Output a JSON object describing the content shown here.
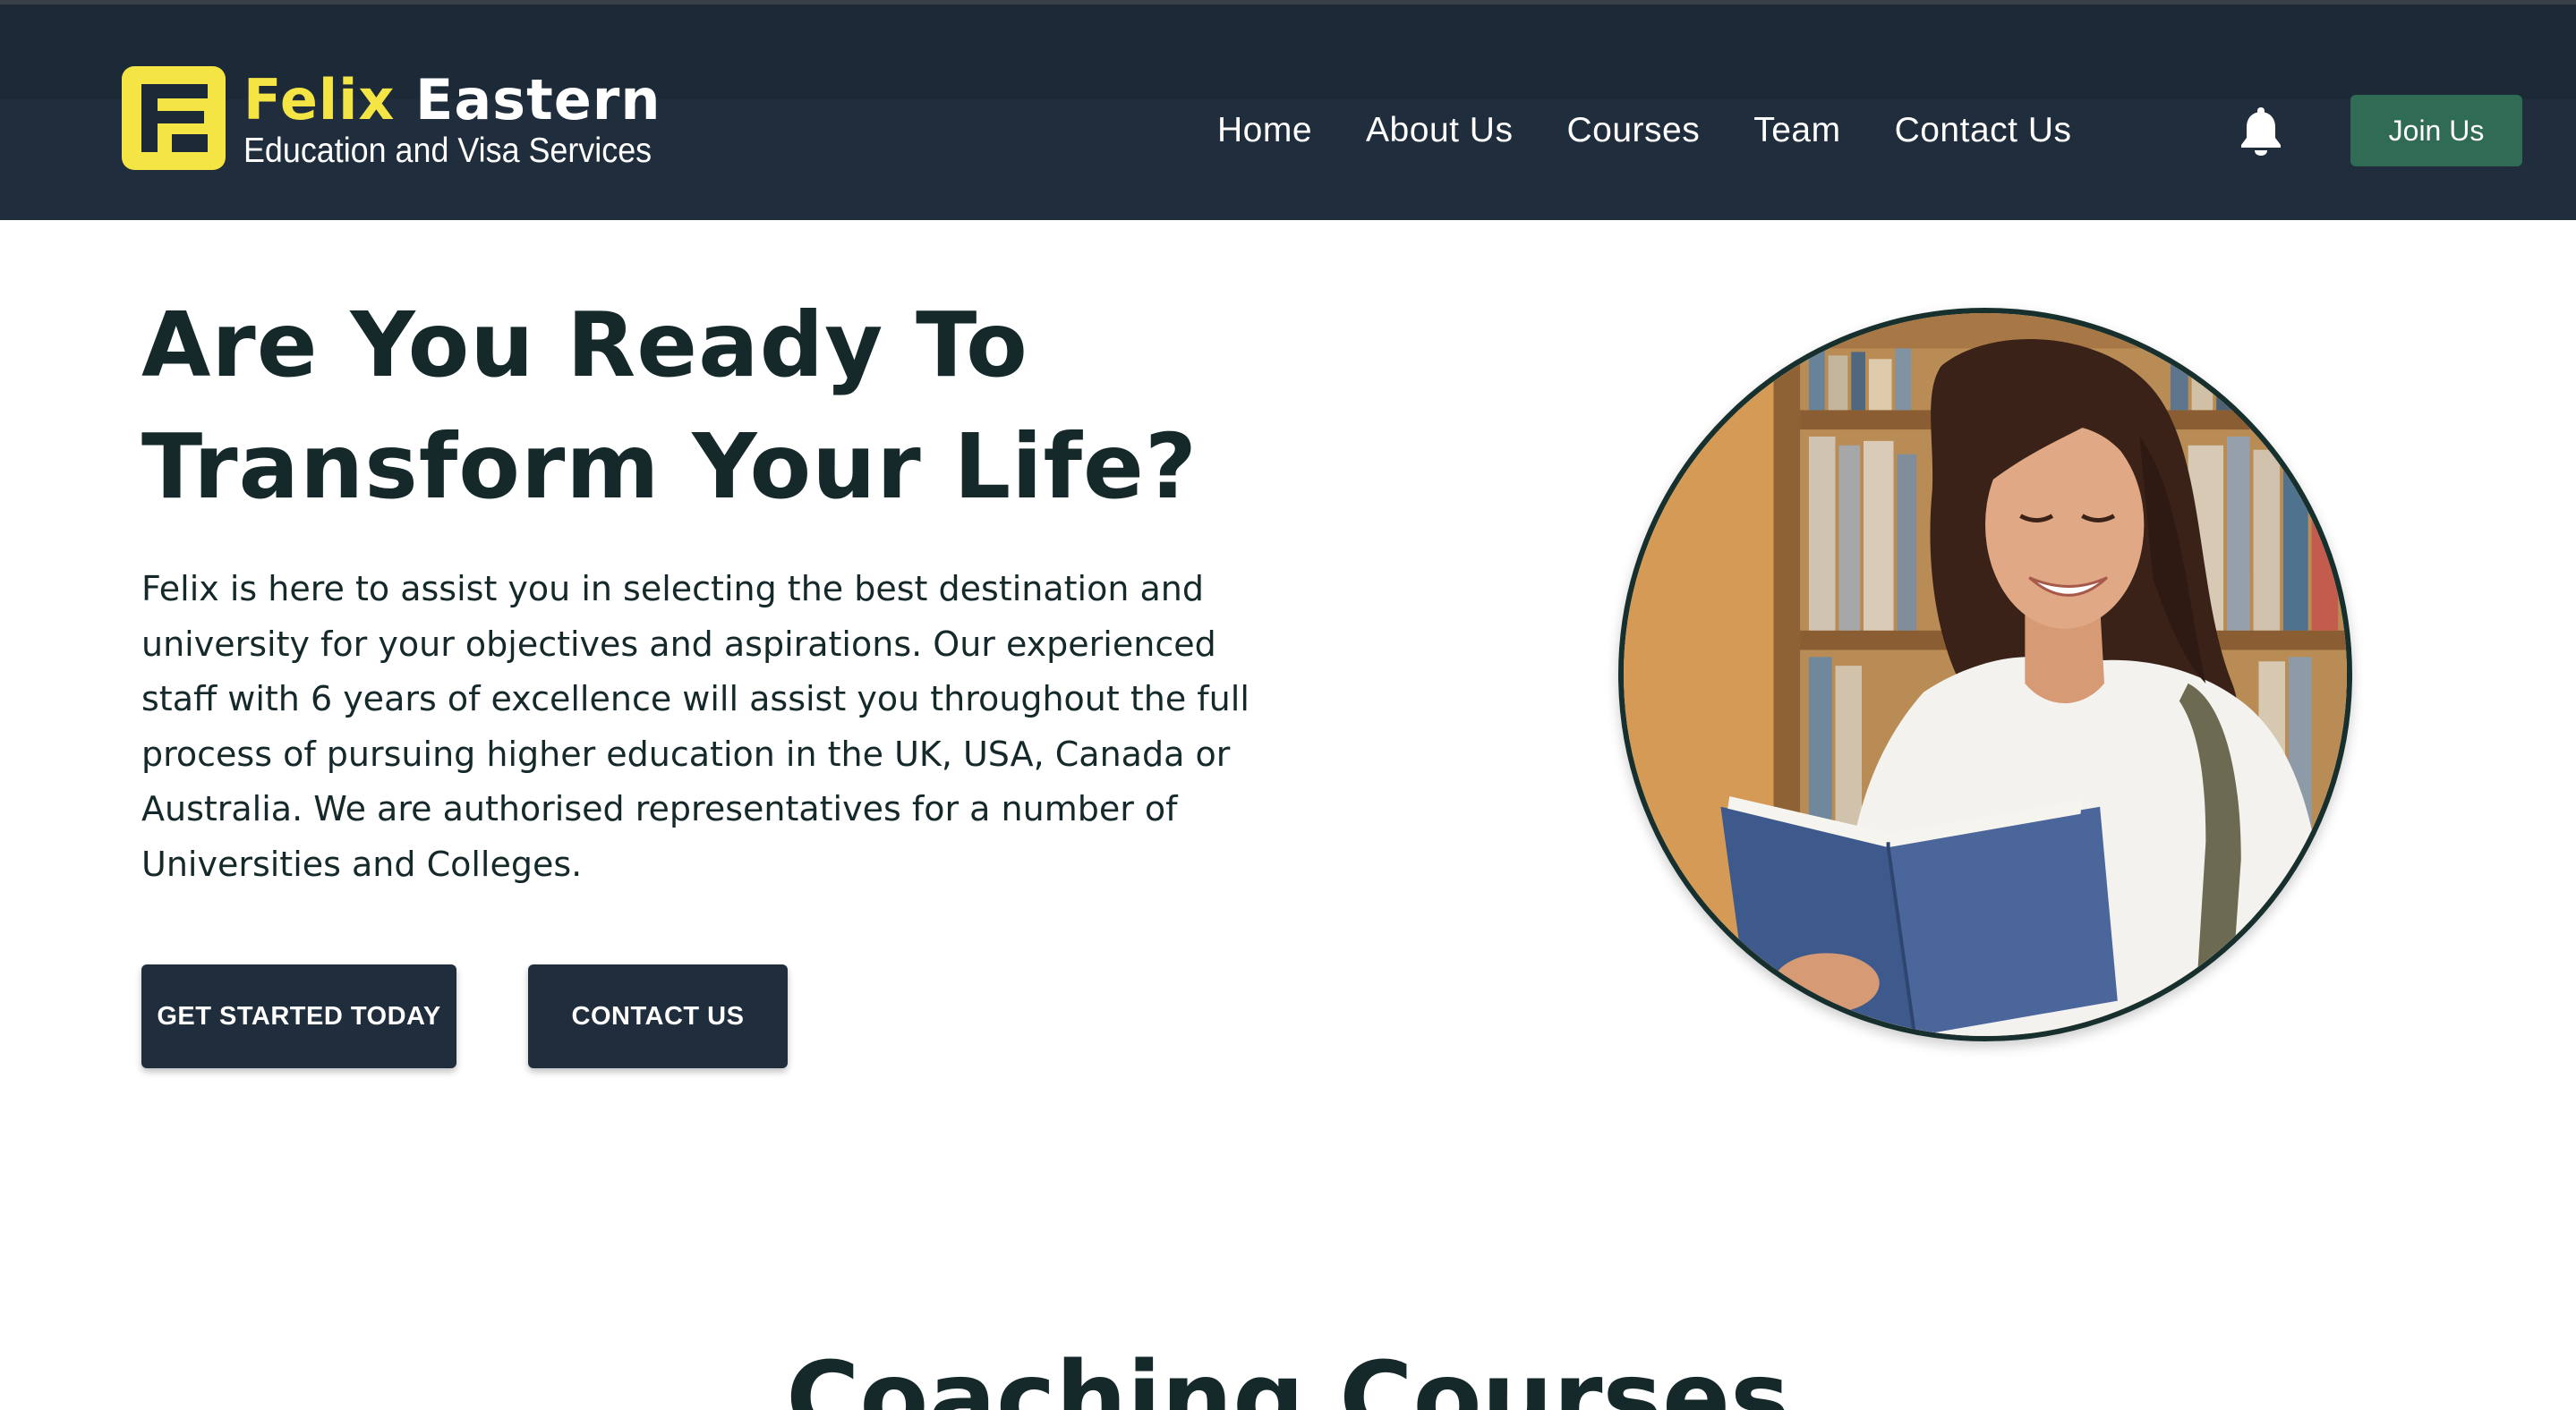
{
  "brand": {
    "name_part1": "Felix",
    "name_part2": "Eastern",
    "tagline": "Education and Visa Services",
    "colors": {
      "header_bg": "#1f2d3c",
      "accent_yellow": "#f4e544",
      "join_green": "#2f6b55",
      "text_dark": "#15292b"
    }
  },
  "nav": {
    "items": [
      {
        "label": "Home"
      },
      {
        "label": "About Us"
      },
      {
        "label": "Courses"
      },
      {
        "label": "Team"
      },
      {
        "label": "Contact Us"
      }
    ],
    "separator": "|",
    "notification_icon": "bell-icon",
    "join_label": "Join Us"
  },
  "hero": {
    "title_line1": "Are You Ready To",
    "title_line2": "Transform Your Life?",
    "description": "Felix is here to assist you in selecting the best destination and university for your objectives and aspirations. Our experienced staff with 6 years of excellence will assist you throughout the full process of pursuing higher education in the UK, USA, Canada or Australia. We are authorised representatives for a number of Universities and Colleges.",
    "primary_button": "GET STARTED TODAY",
    "secondary_button": "CONTACT US",
    "image_icon": "student-reading-photo"
  },
  "courses": {
    "heading": "Coaching Courses"
  }
}
